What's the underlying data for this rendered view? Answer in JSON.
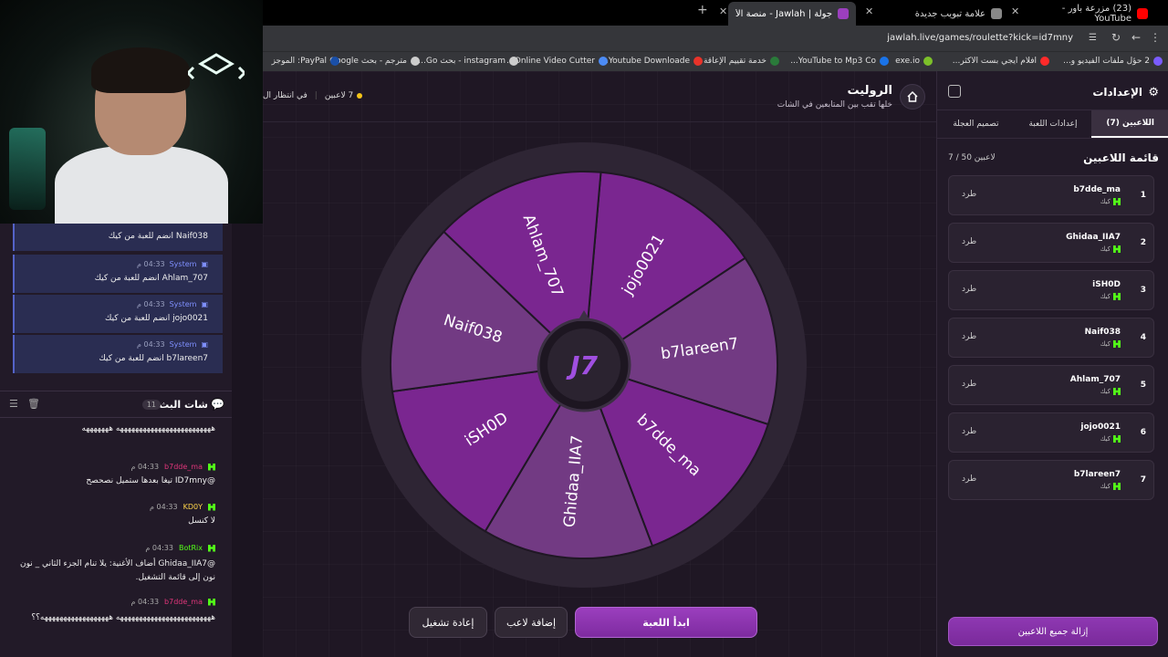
{
  "browser": {
    "tabs": [
      {
        "title": "(23) مزرعة باور - YouTube",
        "color": "#ff0000"
      },
      {
        "title": "علامة تبويب جديدة",
        "color": "#888888"
      },
      {
        "title": "جولة | Jawlah - منصة الألعاب الت",
        "color": "#9b3fbe"
      }
    ],
    "new_tab_label": "+",
    "url": "jawlah.live/games/roulette?kick=id7mny",
    "bookmarks": [
      {
        "label": "2 حؤل ملفات الفيديو و...",
        "color": "#7a5cff"
      },
      {
        "label": "افلام ايجي بست الاكثر...",
        "color": "#ff2a2a"
      },
      {
        "label": "exe.io",
        "color": "#7cc02a"
      },
      {
        "label": "YouTube to Mp3 Co...",
        "color": "#1a73e8"
      },
      {
        "label": "خدمة تقييم الإعاقة",
        "color": "#2a7a3a"
      },
      {
        "label": "Youtube Downloade...",
        "color": "#e8332a"
      },
      {
        "label": "Online Video Cutter...",
        "color": "#4c8bf5"
      },
      {
        "label": "instagram - بحث Go...",
        "color": "#cccccc"
      },
      {
        "label": "مترجم - بحث Google",
        "color": "#cccccc"
      },
      {
        "label": "PayPal: الموجز",
        "color": "#1a4fa8"
      }
    ]
  },
  "left_panel": {
    "system_messages": [
      {
        "sender": "System",
        "time": "04:33 م",
        "text": "Naif038 انضم للعبة من كيك"
      },
      {
        "sender": "System",
        "time": "04:33 م",
        "text": "Ahlam_707 انضم للعبة من كيك"
      },
      {
        "sender": "System",
        "time": "04:33 م",
        "text": "jojo0021 انضم للعبة من كيك"
      },
      {
        "sender": "System",
        "time": "04:33 م",
        "text": "b7lareen7 انضم للعبة من كيك"
      }
    ],
    "chat_title": "شات البث",
    "chat_count": "11",
    "chat_messages": [
      {
        "user": "",
        "user_color": "#ffffff",
        "time": "",
        "text": "هههههههههههههههههههههههههه هههههههه"
      },
      {
        "user": "b7dde_ma",
        "user_color": "#e0357a",
        "time": "04:33 م",
        "text": "@ID7mny تيغا بعدها ستميل نصحصح"
      },
      {
        "user": "KD0Y",
        "user_color": "#ffd54a",
        "time": "04:33 م",
        "text": "لا كنسل"
      },
      {
        "user": "BotRix",
        "user_color": "#53fc18",
        "time": "04:33 م",
        "text": "@Ghidaa_IIA7 أضاف الأغنية: يلا تنام الجزء الثاني _ نون نون إلى قائمة التشغيل."
      },
      {
        "user": "b7dde_ma",
        "user_color": "#e0357a",
        "time": "04:33 م",
        "text": "هههههههههههههههههههههههههه ههههههههههههههههههه؟؟"
      }
    ]
  },
  "main": {
    "title": "الروليت",
    "subtitle": "خلها تقب بين المتابعين في الشات",
    "player_status": "7 لاعبين",
    "waiting_status": "في انتظار ال",
    "start_button": "ابدأ اللعبة",
    "add_player_button": "إضافة لاعب",
    "restart_button": "إعادة تشغيل",
    "wheel": {
      "segments": [
        "jojo0021",
        "b7lareen7",
        "b7dde_ma",
        "Ghidaa_IIA7",
        "iSH0D",
        "Naif038",
        "Ahlam_707"
      ],
      "colors": [
        "#7a2690",
        "#723a83",
        "#7a2690",
        "#723a83",
        "#7a2690",
        "#723a83",
        "#7a2690"
      ],
      "center_logo": "J7"
    }
  },
  "settings": {
    "title": "الإعدادات",
    "tabs": [
      "اللاعبين (7)",
      "إعدادات اللعبة",
      "تصميم العجلة"
    ],
    "player_list_title": "قائمة اللاعبين",
    "player_count": "7 / 50 لاعبين",
    "players": [
      {
        "num": "1",
        "name": "b7dde_ma",
        "platform": "كيك",
        "kick_label": "طرد"
      },
      {
        "num": "2",
        "name": "Ghidaa_IIA7",
        "platform": "كيك",
        "kick_label": "طرد"
      },
      {
        "num": "3",
        "name": "iSH0D",
        "platform": "كيك",
        "kick_label": "طرد"
      },
      {
        "num": "4",
        "name": "Naif038",
        "platform": "كيك",
        "kick_label": "طرد"
      },
      {
        "num": "5",
        "name": "Ahlam_707",
        "platform": "كيك",
        "kick_label": "طرد"
      },
      {
        "num": "6",
        "name": "jojo0021",
        "platform": "كيك",
        "kick_label": "طرد"
      },
      {
        "num": "7",
        "name": "b7lareen7",
        "platform": "كيك",
        "kick_label": "طرد"
      }
    ],
    "remove_all_button": "إزالة جميع اللاعبين"
  }
}
